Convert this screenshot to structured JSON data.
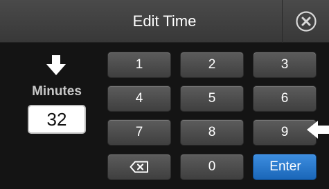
{
  "dialog": {
    "title": "Edit Time",
    "close_icon": "close-circle-icon"
  },
  "indicator": {
    "icon": "down-arrow-icon"
  },
  "minutes": {
    "label": "Minutes",
    "value": "32"
  },
  "keypad": {
    "keys": [
      "1",
      "2",
      "3",
      "4",
      "5",
      "6",
      "7",
      "8",
      "9"
    ],
    "backspace_icon": "backspace-icon",
    "zero": "0",
    "enter": "Enter"
  },
  "pointer": {
    "icon": "left-arrow-icon"
  },
  "colors": {
    "enter_key": "#2a7bd0",
    "key": "#4d4d4d",
    "background": "#141414"
  }
}
